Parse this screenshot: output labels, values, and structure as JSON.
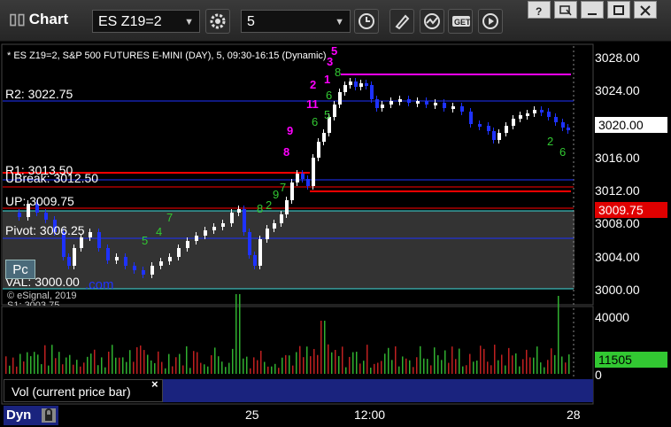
{
  "window": {
    "title": "Chart",
    "symbol": "ES Z19=2",
    "interval": "5",
    "dropdown_arrow": "▼"
  },
  "chart": {
    "header": "* ES Z19=2, S&P 500 FUTURES E-MINI (DAY), 5, 09:30-16:15 (Dynamic)",
    "levels": {
      "r2": "R2: 3022.75",
      "r1": "R1: 3013.50",
      "ubreak": "UBreak: 3012.50",
      "up": "UP: 3009.75",
      "pivot": "Pivot: 3006.25",
      "val": "VAL: 3000.00",
      "copyright": "© eSignal, 2019",
      "partial": "S1: 3003.75",
      "dotcom": ".com"
    },
    "price_axis": [
      "3028.00",
      "3024.00",
      "3020.00",
      "3016.00",
      "3012.00",
      "3008.00",
      "3004.00",
      "3000.00"
    ],
    "price_tag_current": "3020.00",
    "price_tag_level": "3009.75",
    "pc_button": "Pc",
    "vol_axis": [
      "40000",
      "0"
    ],
    "vol_tag": "11505",
    "vol_label": "Vol (current price bar)",
    "vol_close": "×",
    "x_ticks": [
      "25",
      "12:00",
      "28"
    ],
    "dyn_label": "Dyn",
    "counts_magenta": [
      "5",
      "3",
      "1",
      "2",
      "11",
      "9",
      "8"
    ],
    "counts_green": [
      "8",
      "6",
      "5",
      "6",
      "7",
      "9",
      "2",
      "8",
      "7",
      "4",
      "5",
      "2",
      "6"
    ]
  },
  "colors": {
    "background": "#000000",
    "up_candle": "#ffffff",
    "down_candle": "#1e32ff",
    "r_line": "#ff0000",
    "magenta": "#ff00ff",
    "cyan": "#40e0e0",
    "green_tag": "#32c832"
  }
}
